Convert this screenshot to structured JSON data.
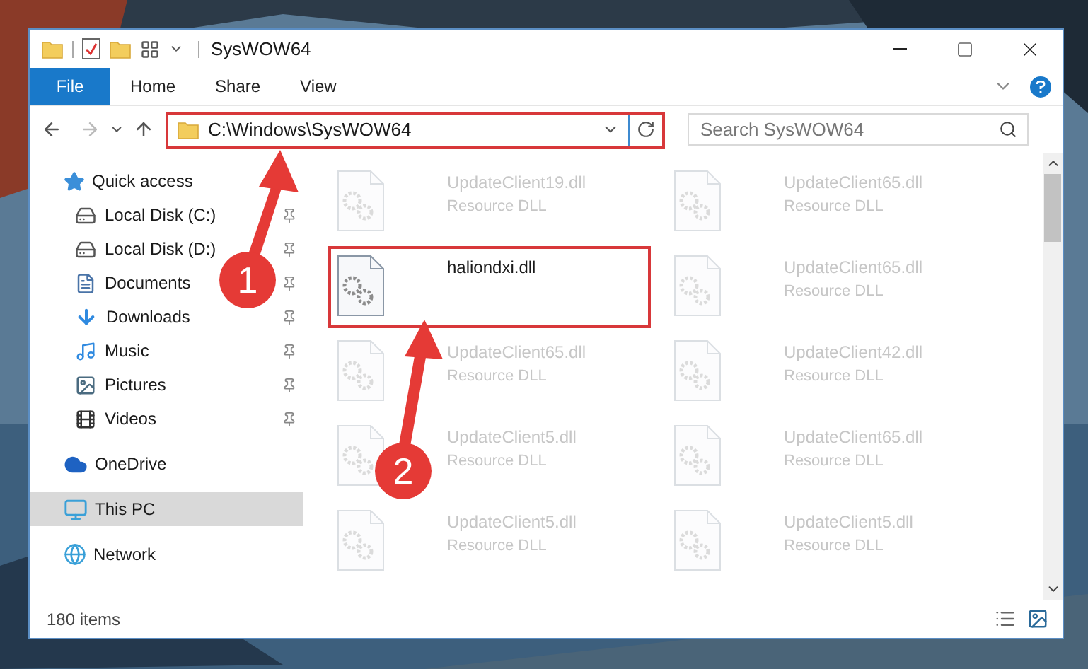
{
  "window": {
    "title": "SysWOW64"
  },
  "ribbon_tabs": [
    {
      "label": "File",
      "selected": true
    },
    {
      "label": "Home",
      "selected": false
    },
    {
      "label": "Share",
      "selected": false
    },
    {
      "label": "View",
      "selected": false
    }
  ],
  "address_bar": {
    "value": "C:\\Windows\\SysWOW64",
    "highlighted": true
  },
  "search": {
    "placeholder": "Search SysWOW64"
  },
  "nav_pane": [
    {
      "label": "Quick access",
      "selected": false,
      "children": [
        {
          "label": "Local Disk (C:)",
          "pinned": true
        },
        {
          "label": "Local Disk (D:)",
          "pinned": true
        },
        {
          "label": "Documents",
          "pinned": true
        },
        {
          "label": "Downloads",
          "pinned": true
        },
        {
          "label": "Music",
          "pinned": true
        },
        {
          "label": "Pictures",
          "pinned": true
        },
        {
          "label": "Videos",
          "pinned": true
        }
      ]
    },
    {
      "label": "OneDrive",
      "selected": false
    },
    {
      "label": "This PC",
      "selected": true
    },
    {
      "label": "Network",
      "selected": false
    }
  ],
  "files": [
    {
      "name": "UpdateClient19.dll",
      "type": "Resource DLL",
      "faded": true,
      "highlighted": false
    },
    {
      "name": "UpdateClient65.dll",
      "type": "Resource DLL",
      "faded": true,
      "highlighted": false
    },
    {
      "name": "haliondxi.dll",
      "faded": false,
      "highlighted": true
    },
    {
      "name": "UpdateClient65.dll",
      "type": "Resource DLL",
      "faded": true,
      "highlighted": false
    },
    {
      "name": "UpdateClient65.dll",
      "type": "Resource DLL",
      "faded": true,
      "highlighted": false
    },
    {
      "name": "UpdateClient42.dll",
      "type": "Resource DLL",
      "faded": true,
      "highlighted": false
    },
    {
      "name": "UpdateClient5.dll",
      "type": "Resource DLL",
      "faded": true,
      "highlighted": false
    },
    {
      "name": "UpdateClient65.dll",
      "type": "Resource DLL",
      "faded": true,
      "highlighted": false
    },
    {
      "name": "UpdateClient5.dll",
      "type": "Resource DLL",
      "faded": true,
      "highlighted": false
    },
    {
      "name": "UpdateClient5.dll",
      "type": "Resource DLL",
      "faded": true,
      "highlighted": false
    }
  ],
  "status_bar": {
    "item_count": "180 items"
  },
  "annotations": [
    {
      "number": "1"
    },
    {
      "number": "2"
    }
  ]
}
